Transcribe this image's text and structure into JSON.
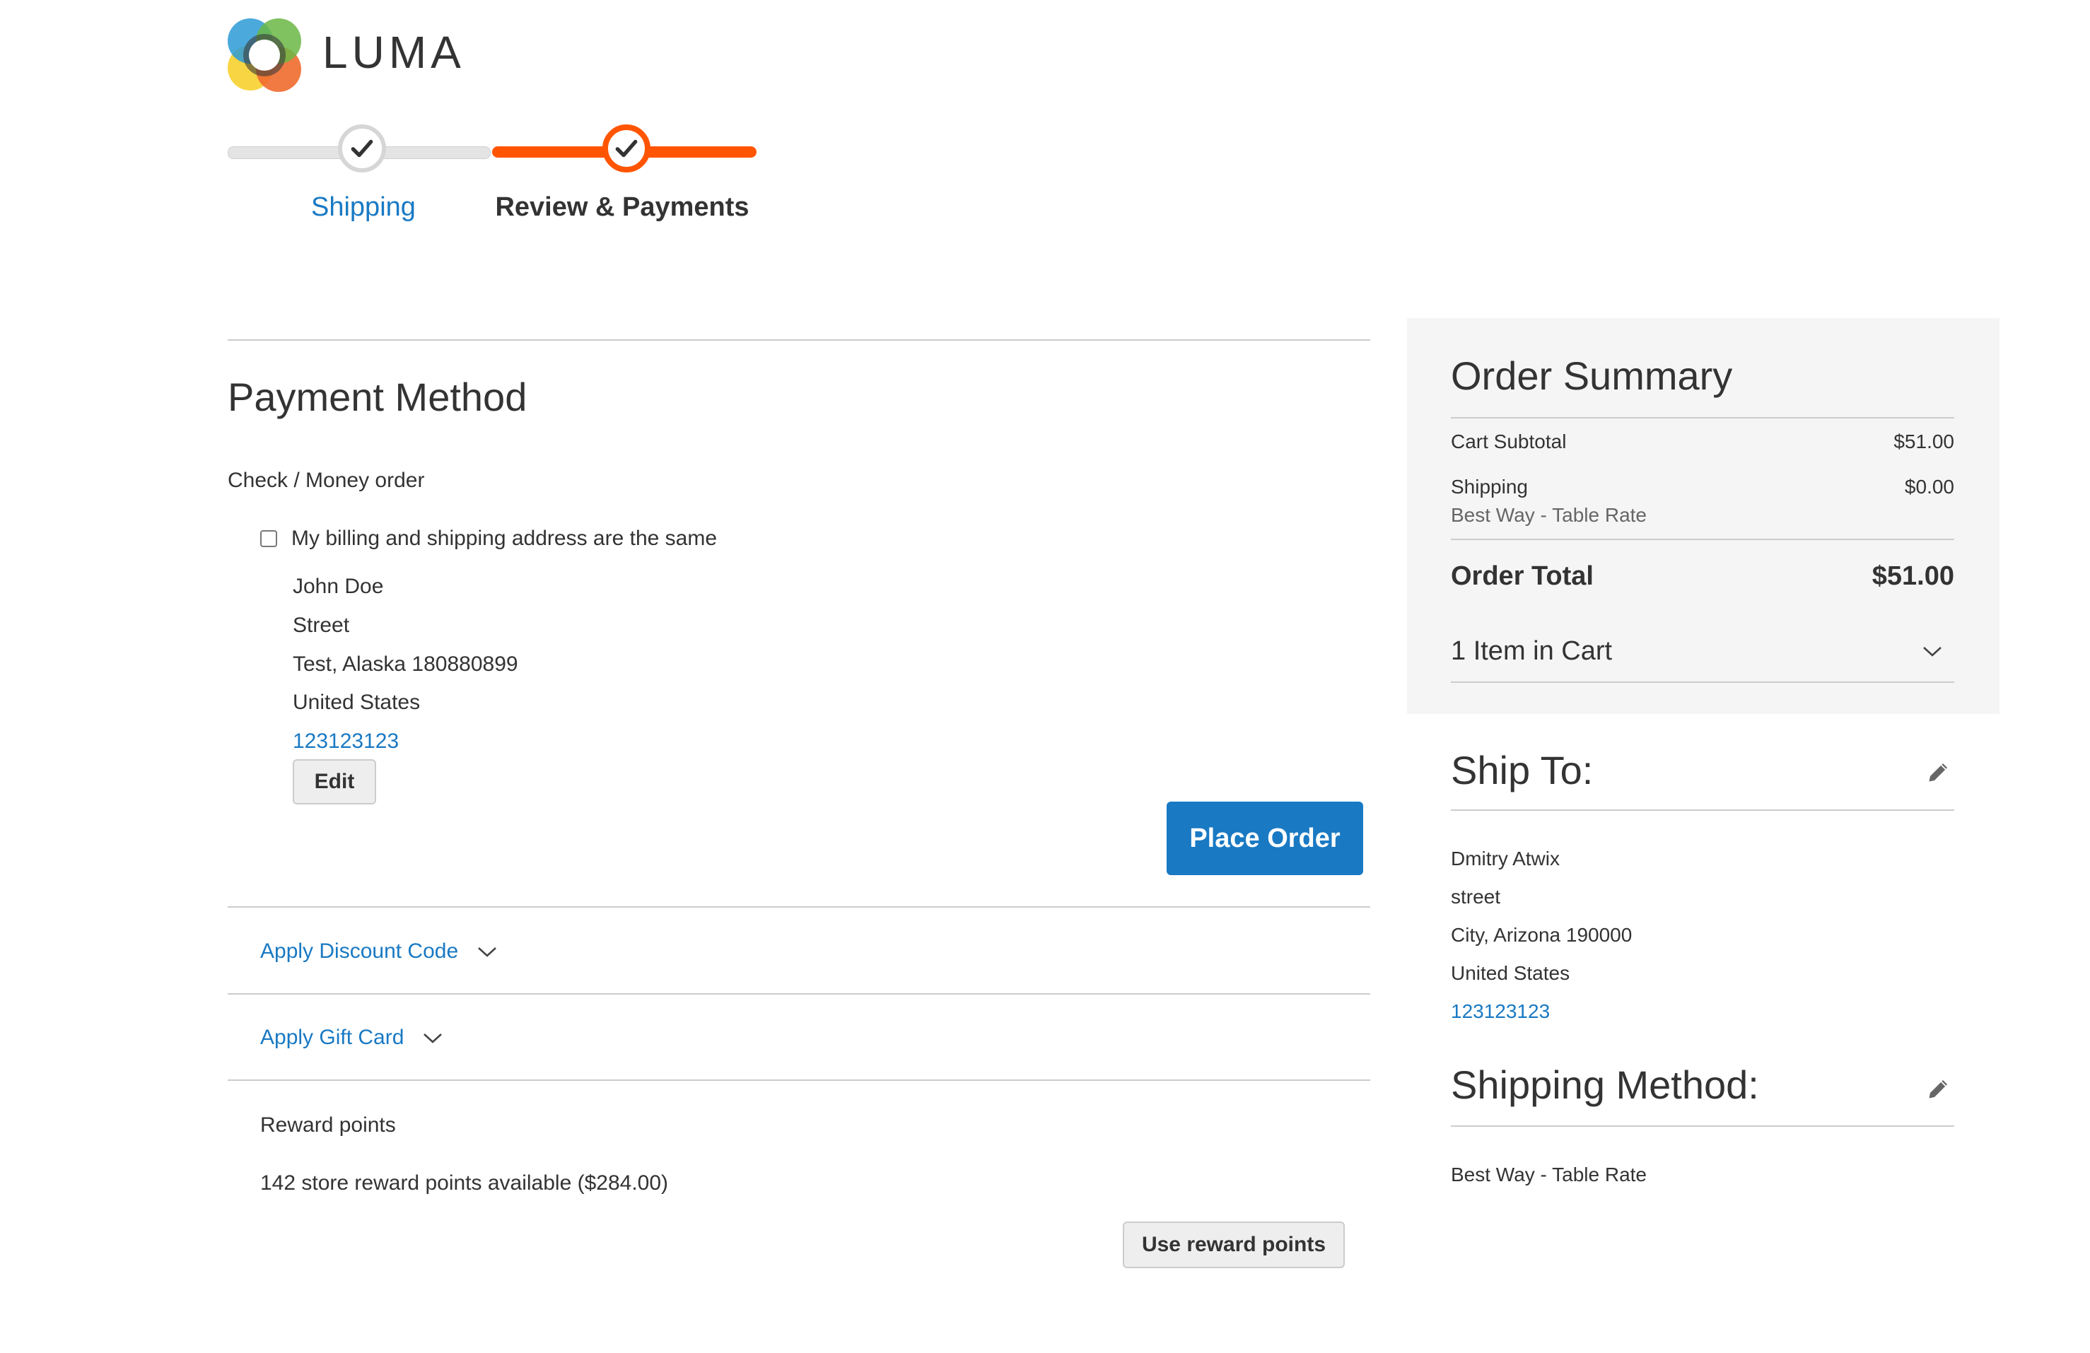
{
  "logo": {
    "text": "LUMA"
  },
  "progress": {
    "steps": [
      {
        "label": "Shipping",
        "state": "complete"
      },
      {
        "label": "Review & Payments",
        "state": "active"
      }
    ]
  },
  "payment": {
    "title": "Payment Method",
    "method_label": "Check / Money order",
    "same_address_label": "My billing and shipping address are the same",
    "same_address_checked": false,
    "billing_address": {
      "name": "John Doe",
      "street": "Street",
      "city_line": "Test, Alaska 180880899",
      "country": "United States",
      "phone": "123123123"
    },
    "edit_label": "Edit",
    "place_order_label": "Place Order"
  },
  "discount": {
    "label": "Apply Discount Code"
  },
  "gift_card": {
    "label": "Apply Gift Card"
  },
  "reward": {
    "title": "Reward points",
    "available_text": "142 store reward points available ($284.00)",
    "button_label": "Use reward points"
  },
  "summary": {
    "title": "Order Summary",
    "rows": [
      {
        "label": "Cart Subtotal",
        "value": "$51.00"
      },
      {
        "label": "Shipping",
        "sublabel": "Best Way - Table Rate",
        "value": "$0.00"
      }
    ],
    "total_label": "Order Total",
    "total_value": "$51.00",
    "items_label": "1 Item in Cart"
  },
  "ship_to": {
    "title": "Ship To:",
    "name": "Dmitry Atwix",
    "street": "street",
    "city_line": "City, Arizona 190000",
    "country": "United States",
    "phone": "123123123"
  },
  "shipping_method": {
    "title": "Shipping Method:",
    "value": "Best Way - Table Rate"
  },
  "colors": {
    "accent_orange": "#ff5501",
    "link_blue": "#1979c3",
    "primary_button": "#1979c3",
    "summary_bg": "#f5f5f5"
  },
  "icons": [
    "luma-logo",
    "check-icon",
    "chevron-down-icon",
    "pencil-icon"
  ]
}
